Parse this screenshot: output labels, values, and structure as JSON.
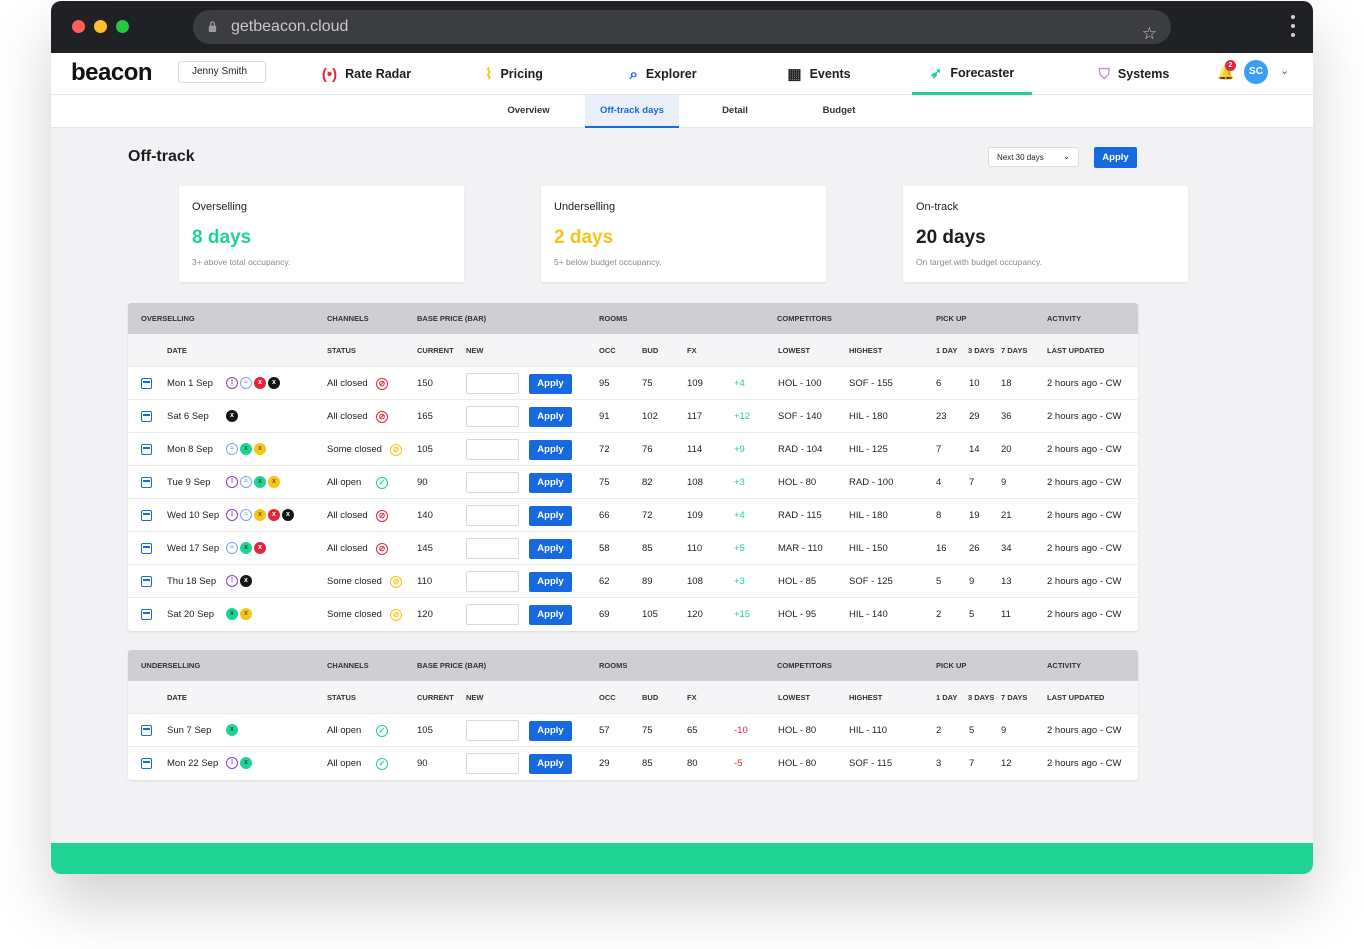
{
  "browser": {
    "url": "getbeacon.cloud"
  },
  "nav": {
    "logo": "beacon",
    "user": "Jenny Smith",
    "items": [
      {
        "label": "Rate Radar",
        "icon": "radar-icon"
      },
      {
        "label": "Pricing",
        "icon": "pulse-icon"
      },
      {
        "label": "Explorer",
        "icon": "magnifier-icon"
      },
      {
        "label": "Events",
        "icon": "calendar-icon"
      },
      {
        "label": "Forecaster",
        "icon": "rocket-icon"
      },
      {
        "label": "Systems",
        "icon": "shield-icon"
      }
    ],
    "active": "Forecaster",
    "notifications": "2",
    "avatar": "SC"
  },
  "subnav": {
    "tabs": [
      "Overview",
      "Off-track days",
      "Detail",
      "Budget"
    ],
    "active": "Off-track days"
  },
  "page": {
    "title": "Off-track",
    "range": "Next 30 days",
    "apply": "Apply"
  },
  "cards": [
    {
      "label": "Overselling",
      "value": "8 days",
      "desc": "3+ above total occupancy.",
      "color": "#1ed394"
    },
    {
      "label": "Underselling",
      "value": "2 days",
      "desc": "5+ below budget occupancy.",
      "color": "#f6c416"
    },
    {
      "label": "On-track",
      "value": "20 days",
      "desc": "On target with budget occupancy.",
      "color": "#1d1d1f"
    }
  ],
  "colors": {
    "accent": "#1769e0",
    "green": "#1ed394",
    "red": "#e5243b",
    "yellow": "#f6c416"
  },
  "group_headers": {
    "channels": "CHANNELS",
    "base_price": "BASE PRICE (BAR)",
    "rooms": "ROOMS",
    "competitors": "COMPETITORS",
    "pickup": "PICK UP",
    "activity": "ACTIVITY"
  },
  "sub_headers": {
    "date": "DATE",
    "status": "STATUS",
    "current": "CURRENT",
    "new": "NEW",
    "occ": "OCC",
    "bud": "BUD",
    "fx": "FX",
    "lowest": "LOWEST",
    "highest": "HIGHEST",
    "d1": "1 DAY",
    "d3": "3 DAYS",
    "d7": "7 DAYS",
    "updated": "LAST UPDATED"
  },
  "tables": [
    {
      "title": "OVERSELLING",
      "rows": [
        {
          "date": "Mon 1 Sep",
          "channels": [
            "p",
            "b",
            "r",
            "k"
          ],
          "status": "All closed",
          "status_type": "closed",
          "current": "150",
          "occ": "95",
          "bud": "75",
          "fx": "109",
          "diff": "+4",
          "lowest": "HOL - 100",
          "highest": "SOF - 155",
          "d1": "6",
          "d3": "10",
          "d7": "18",
          "updated": "2 hours ago - CW"
        },
        {
          "date": "Sat 6 Sep",
          "channels": [
            "k"
          ],
          "status": "All closed",
          "status_type": "closed",
          "current": "165",
          "occ": "91",
          "bud": "102",
          "fx": "117",
          "diff": "+12",
          "lowest": "SOF - 140",
          "highest": "HIL - 180",
          "d1": "23",
          "d3": "29",
          "d7": "36",
          "updated": "2 hours ago - CW"
        },
        {
          "date": "Mon 8 Sep",
          "channels": [
            "b",
            "g",
            "y"
          ],
          "status": "Some closed",
          "status_type": "some",
          "current": "105",
          "occ": "72",
          "bud": "76",
          "fx": "114",
          "diff": "+9",
          "lowest": "RAD - 104",
          "highest": "HIL - 125",
          "d1": "7",
          "d3": "14",
          "d7": "20",
          "updated": "2 hours ago - CW"
        },
        {
          "date": "Tue 9 Sep",
          "channels": [
            "p",
            "b",
            "g",
            "y"
          ],
          "status": "All open",
          "status_type": "open",
          "current": "90",
          "occ": "75",
          "bud": "82",
          "fx": "108",
          "diff": "+3",
          "lowest": "HOL - 80",
          "highest": "RAD - 100",
          "d1": "4",
          "d3": "7",
          "d7": "9",
          "updated": "2 hours ago - CW"
        },
        {
          "date": "Wed 10 Sep",
          "channels": [
            "p",
            "b",
            "y",
            "r",
            "k"
          ],
          "status": "All closed",
          "status_type": "closed",
          "current": "140",
          "occ": "66",
          "bud": "72",
          "fx": "109",
          "diff": "+4",
          "lowest": "RAD - 115",
          "highest": "HIL - 180",
          "d1": "8",
          "d3": "19",
          "d7": "21",
          "updated": "2 hours ago - CW"
        },
        {
          "date": "Wed 17 Sep",
          "channels": [
            "b",
            "g",
            "r"
          ],
          "status": "All closed",
          "status_type": "closed",
          "current": "145",
          "occ": "58",
          "bud": "85",
          "fx": "110",
          "diff": "+5",
          "lowest": "MAR - 110",
          "highest": "HIL - 150",
          "d1": "16",
          "d3": "26",
          "d7": "34",
          "updated": "2 hours ago - CW"
        },
        {
          "date": "Thu 18 Sep",
          "channels": [
            "p",
            "k"
          ],
          "status": "Some closed",
          "status_type": "some",
          "current": "110",
          "occ": "62",
          "bud": "89",
          "fx": "108",
          "diff": "+3",
          "lowest": "HOL - 85",
          "highest": "SOF - 125",
          "d1": "5",
          "d3": "9",
          "d7": "13",
          "updated": "2 hours ago - CW"
        },
        {
          "date": "Sat 20 Sep",
          "channels": [
            "g",
            "y"
          ],
          "status": "Some closed",
          "status_type": "some",
          "current": "120",
          "occ": "69",
          "bud": "105",
          "fx": "120",
          "diff": "+15",
          "lowest": "HOL - 95",
          "highest": "HIL - 140",
          "d1": "2",
          "d3": "5",
          "d7": "11",
          "updated": "2 hours ago - CW"
        }
      ]
    },
    {
      "title": "UNDERSELLING",
      "rows": [
        {
          "date": "Sun 7 Sep",
          "channels": [
            "g"
          ],
          "status": "All open",
          "status_type": "open",
          "current": "105",
          "occ": "57",
          "bud": "75",
          "fx": "65",
          "diff": "-10",
          "lowest": "HOL - 80",
          "highest": "HIL - 110",
          "d1": "2",
          "d3": "5",
          "d7": "9",
          "updated": "2 hours ago - CW"
        },
        {
          "date": "Mon 22 Sep",
          "channels": [
            "p",
            "g"
          ],
          "status": "All open",
          "status_type": "open",
          "current": "90",
          "occ": "29",
          "bud": "85",
          "fx": "80",
          "diff": "-5",
          "lowest": "HOL - 80",
          "highest": "SOF - 115",
          "d1": "3",
          "d3": "7",
          "d7": "12",
          "updated": "2 hours ago - CW"
        }
      ]
    }
  ]
}
